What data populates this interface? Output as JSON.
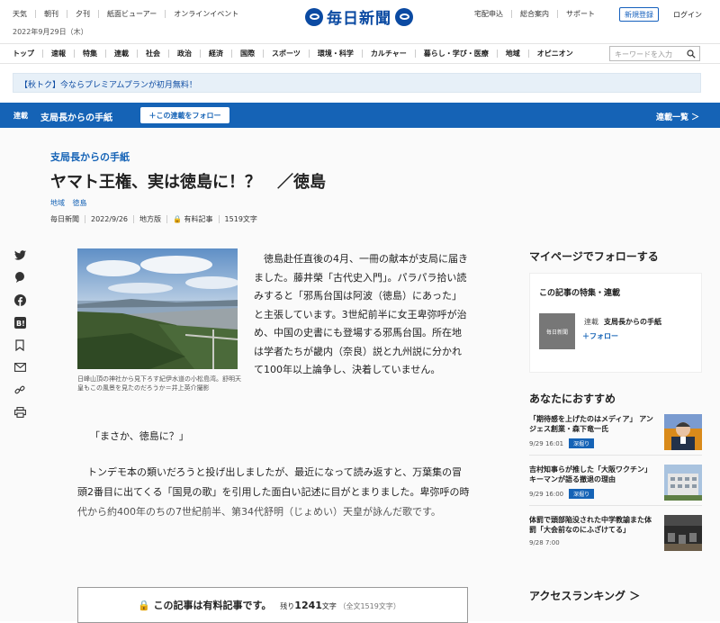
{
  "header": {
    "links": [
      "天気",
      "朝刊",
      "夕刊",
      "紙面ビューアー",
      "オンラインイベント"
    ],
    "date": "2022年9月29日（木）",
    "logo": "毎日新聞",
    "right_links": [
      "宅配申込",
      "総合案内",
      "サポート"
    ],
    "register": "新規登録",
    "login": "ログイン"
  },
  "nav": {
    "items": [
      "トップ",
      "速報",
      "特集",
      "連載",
      "社会",
      "政治",
      "経済",
      "国際",
      "スポーツ",
      "環境・科学",
      "カルチャー",
      "暮らし・学び・医療",
      "地域",
      "オピニオン"
    ],
    "search_placeholder": "キーワードを入力",
    "search_icon": "search-icon"
  },
  "promo": "【秋トク】今ならプレミアムプランが初月無料！",
  "series_bar": {
    "tag": "連載",
    "name": "支局長からの手紙",
    "follow": "＋この連載をフォロー",
    "list": "連載一覧 ＞"
  },
  "article": {
    "series": "支局長からの手紙",
    "title": "ヤマト王権、実は徳島に！？　／徳島",
    "tags": [
      "地域",
      "徳島"
    ],
    "meta": {
      "source": "毎日新聞",
      "date": "2022/9/26",
      "edition": "地方版",
      "paid": "有料記事",
      "chars": "1519文字"
    },
    "caption": "日峰山頂の神社から見下ろす紀伊水道の小松島湾。舒明天皇もこの風景を見たのだろうか＝井上英介撮影",
    "body1": "徳島赴任直後の4月、一冊の献本が支局に届きました。藤井榮「古代史入門」。パラパラ拾い読みすると「邪馬台国は阿波（徳島）にあった」と主張しています。3世紀前半に女王卑弥呼が治め、中国の史書にも登場する邪馬台国。所在地は学者たちが畿内（奈良）説と九州説に分かれて100年以上論争し、決着していません。",
    "quote": "「まさか、徳島に？」",
    "body2": "トンデモ本の類いだろうと投げ出しましたが、最近になって読み返すと、万葉集の冒頭2番目に出てくる「国見の歌」を引用した面白い記述に目がとまりました。卑弥呼の時代から約400年のちの7世紀前半、第34代舒明（じょめい）天皇が詠んだ歌です。",
    "paywall": {
      "label": "この記事は有料記事です。",
      "rest_prefix": "残り",
      "rest_num": "1241",
      "rest_suffix": "文字",
      "total": "（全文1519文字）"
    }
  },
  "sidebar": {
    "mypage": "マイページでフォローする",
    "follow_box": {
      "title": "この記事の特集・連載",
      "thumb": "毎日新聞",
      "kind": "連載",
      "name": "支局長からの手紙",
      "follow": "＋フォロー"
    },
    "rec_title": "あなたにおすすめ",
    "rec": [
      {
        "title": "「期待感を上げたのはメディア」 アンジェス創業・森下竜一氏",
        "date": "9/29 16:01",
        "badge": "深掘り"
      },
      {
        "title": "吉村知事らが推した「大阪ワクチン」 キーマンが語る撤退の理由",
        "date": "9/29 16:00",
        "badge": "深掘り"
      },
      {
        "title": "体罰で頭部陥没された中学教諭また体罰「大会前なのにふざけてる」",
        "date": "9/28 7:00",
        "badge": ""
      }
    ],
    "ranking": "アクセスランキング ＞"
  }
}
